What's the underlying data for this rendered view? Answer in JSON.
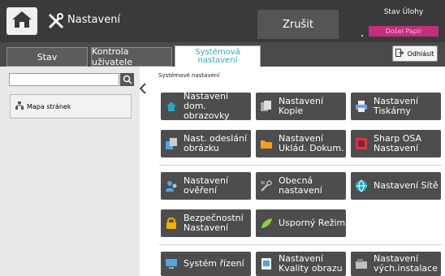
{
  "header": {
    "title": "Nastavení",
    "cancel_label": "Zrušit",
    "job_status_label": "Stav Úlohy",
    "job_status_badge": "Došel Papír"
  },
  "tabs": [
    {
      "label": "Stav"
    },
    {
      "label": "Kontrola uživatele"
    },
    {
      "label": "Systémová nastavení"
    }
  ],
  "logout_label": "Odhlásit",
  "sidebar": {
    "search_placeholder": "",
    "sitemap_label": "Mapa stránek"
  },
  "breadcrumb": "Systémové nastavení",
  "tiles": [
    {
      "label": "Nastavení dom. obrazovky",
      "icon": "home-icon",
      "color": "#2aa6c0"
    },
    {
      "label": "Nastavení Kopie",
      "icon": "copy-icon",
      "color": "#c0c0c0"
    },
    {
      "label": "Nastavení Tiskárny",
      "icon": "printer-icon",
      "color": "#6aa0ff"
    },
    {
      "label": "Nast. odeslání obrázku",
      "icon": "send-image-icon",
      "color": "#4fa7e0"
    },
    {
      "label": "Nastavení Uklád. Dokum.",
      "icon": "folder-icon",
      "color": "#f0a020"
    },
    {
      "label": "Sharp OSA Nastavení",
      "icon": "osa-icon",
      "color": "#d03a50"
    },
    {
      "label": "Nastavení ověření",
      "icon": "authentication-icon",
      "color": "#4fa7e0"
    },
    {
      "label": "Obecná nastavení",
      "icon": "general-settings-icon",
      "color": "#bbbbbb"
    },
    {
      "label": "Nastavení Sítě",
      "icon": "network-icon",
      "color": "#2aa6c0"
    },
    {
      "label": "Bezpečnostní Nastavení",
      "icon": "lock-icon",
      "color": "#f0b000"
    },
    {
      "label": "Úsporný Režim",
      "icon": "eco-leaf-icon",
      "color": "#8fd040"
    },
    {
      "label": "Systém řízení",
      "icon": "system-control-icon",
      "color": "#4fa7e0"
    },
    {
      "label": "Nastavení Kvality obrazu",
      "icon": "image-quality-icon",
      "color": "#4fa7e0"
    },
    {
      "label": "Nastavení vých.instalace",
      "icon": "default-install-icon",
      "color": "#c0c0c0"
    }
  ]
}
